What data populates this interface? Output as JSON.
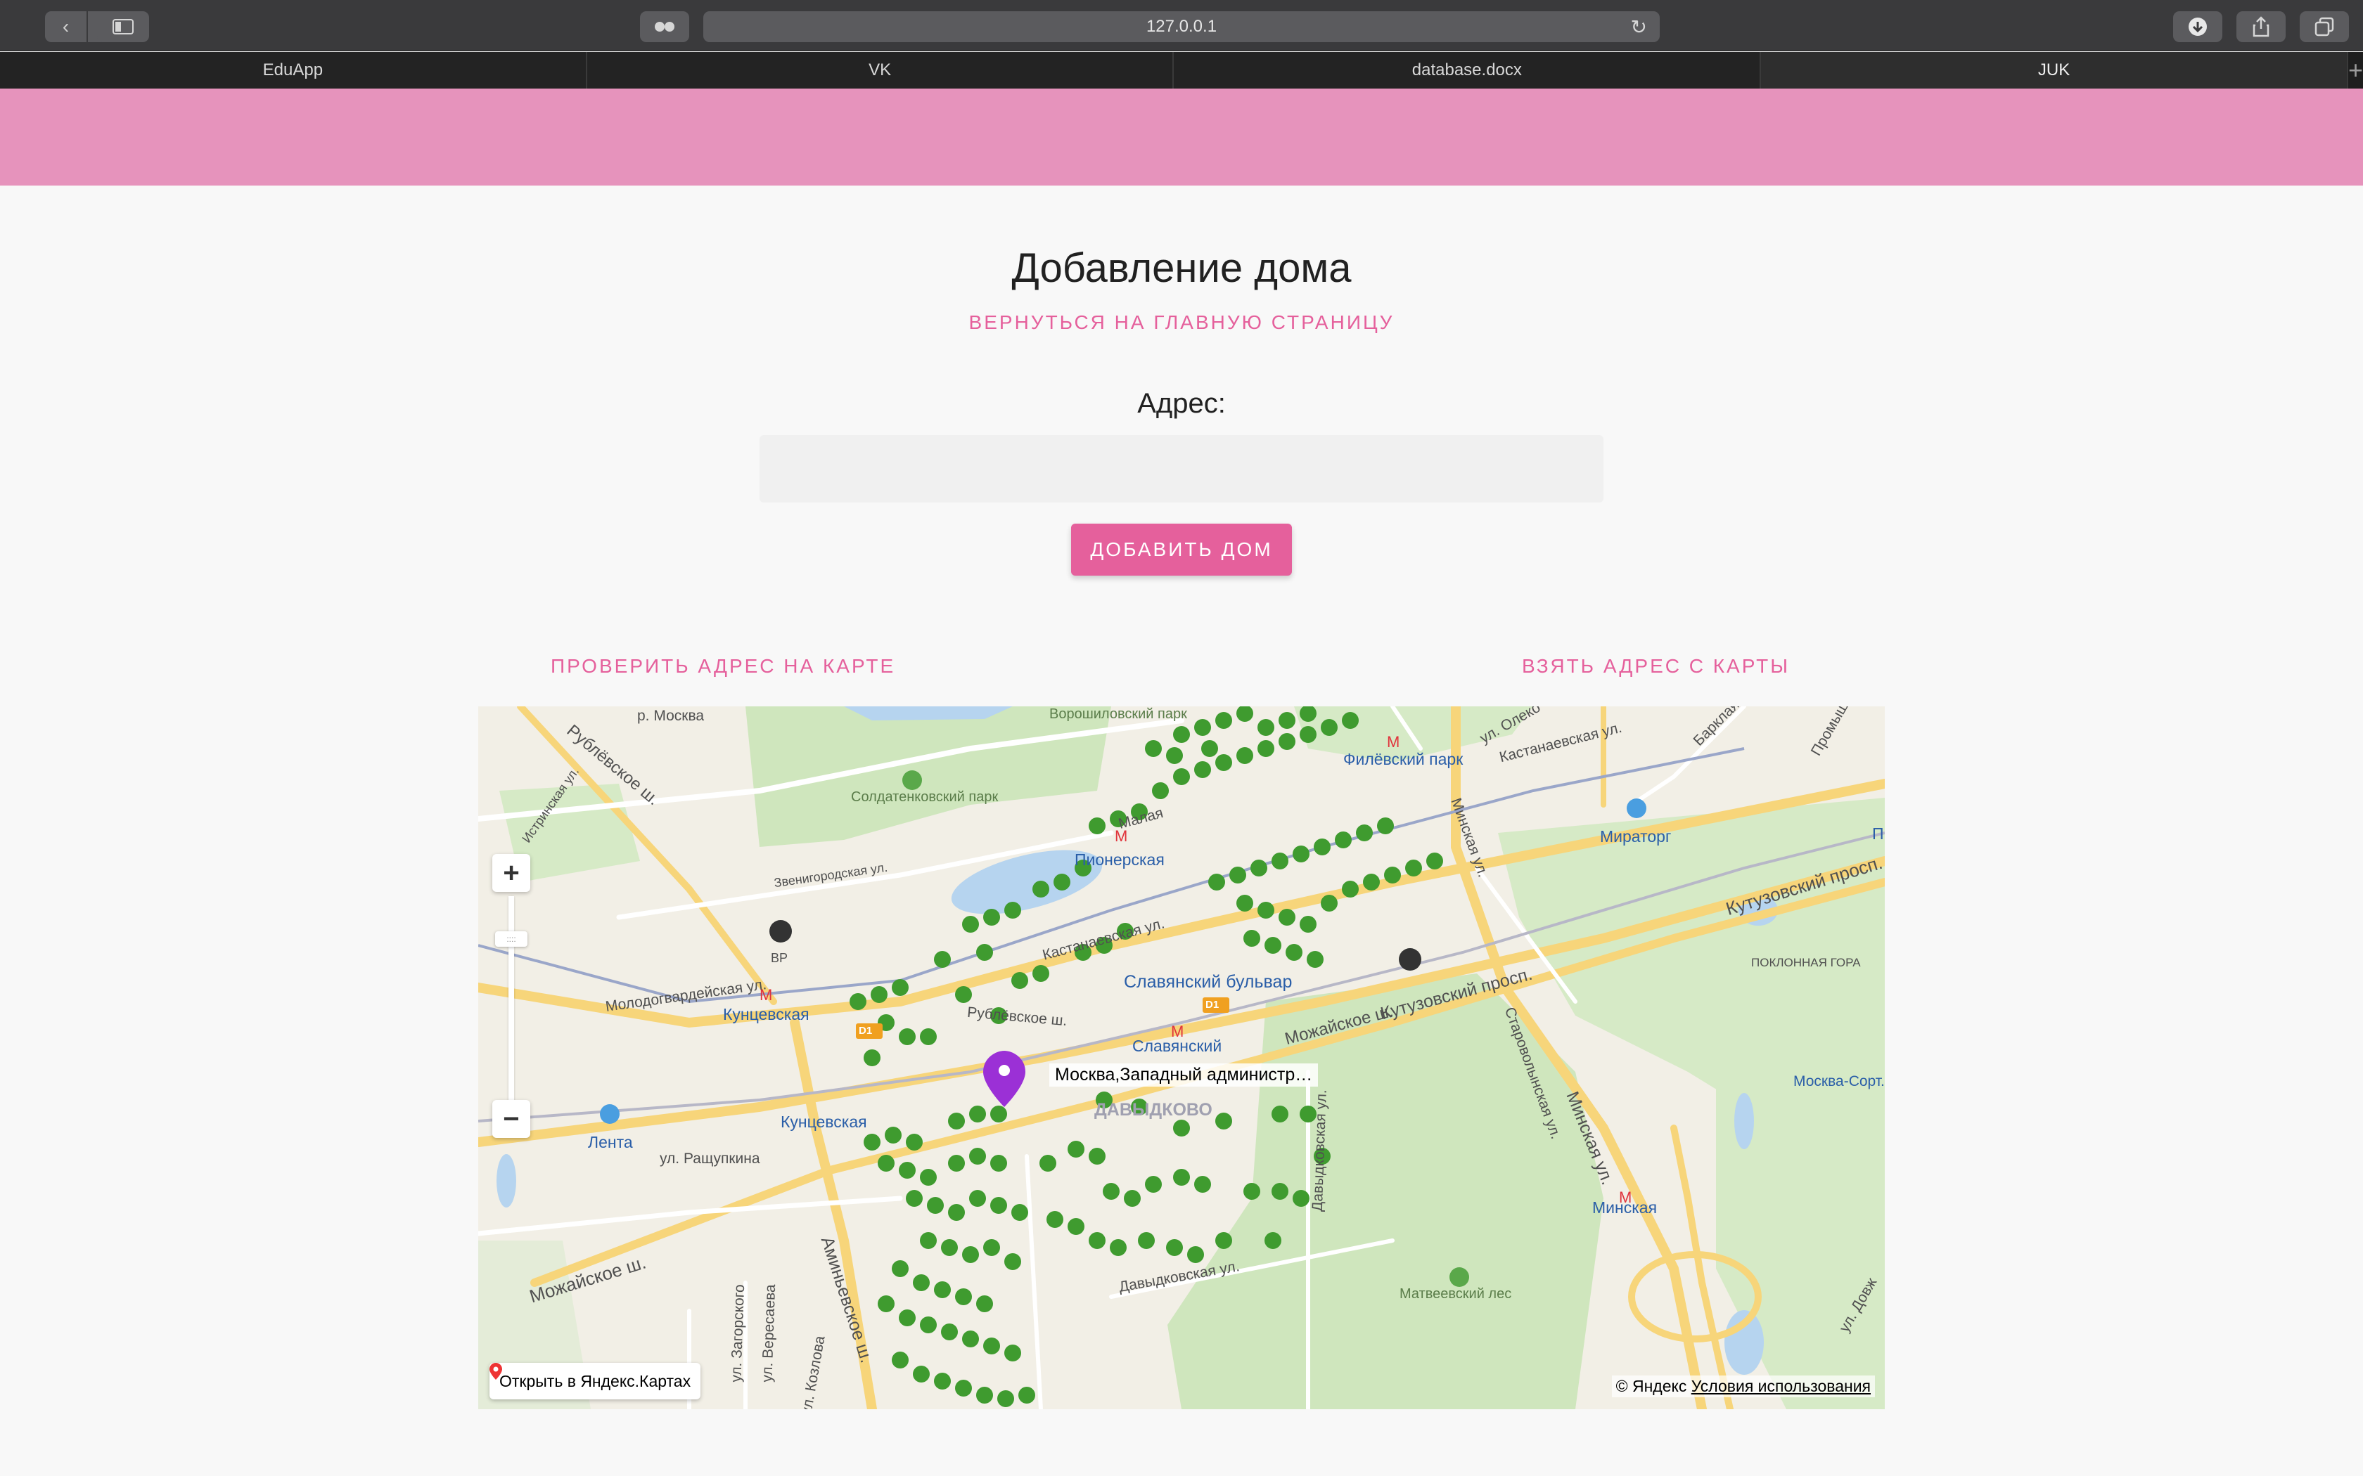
{
  "browser": {
    "url": "127.0.0.1",
    "tabs": [
      {
        "label": "EduApp"
      },
      {
        "label": "VK"
      },
      {
        "label": "database.docx"
      },
      {
        "label": "JUK"
      }
    ]
  },
  "page": {
    "title": "Добавление дома",
    "back_link": "Вернуться на главную страницу",
    "address_label": "Адрес:",
    "address_value": "",
    "address_placeholder": "",
    "add_button": "Добавить дом",
    "check_link": "Проверить адрес на карте",
    "take_link": "Взять адрес с карты",
    "accent_color": "#e5609c",
    "header_color": "#e693bc"
  },
  "map": {
    "marker_label": "Москва,Западный администр…",
    "open_link": "Открыть в Яндекс.Картах",
    "copyright": "© Яндекс",
    "terms": "Условия использования",
    "zoom_in": "+",
    "zoom_out": "−",
    "zoom_thumb": "::::",
    "labels": {
      "moskva_river": "р. Москва",
      "voroshilovsky": "Ворошиловский парк",
      "soldatenkovsky": "Солдатенковский парк",
      "filevsky": "Филёвский парк",
      "kastanaevskaya1": "Кастанаевская ул.",
      "miratorg": "Мираторг",
      "olenya": "ул. Олеко",
      "barklaya": "Барклая",
      "promyshlennaya": "Промыш",
      "rublevskoe1": "Рублёвское ш.",
      "istrinskaya": "Истринская ул.",
      "zvenigorodskaya": "Звенигородская ул.",
      "malaya": "Малая",
      "pionerskaya": "Пионерская",
      "minskaya1": "Минская ул.",
      "kutuzovsky1": "Кутузовский просп.",
      "poklonnaya": "ПОКЛОННАЯ ГОРА",
      "bp": "ВР",
      "kastanaevskaya2": "Кастанаевская ул.",
      "slavyansky_bulvar": "Славянский бульвар",
      "slavyansky": "Славянский",
      "molodogvardeyskaya": "Молодогвардейская ул.",
      "kuntsevskaya1": "Кунцевская",
      "rublevskoe2": "Рублёвское ш.",
      "kutuzovsky2": "Кутузовский просп.",
      "starovolynskaya": "Староволынская ул.",
      "mozhayskoe1": "Можайское ш.",
      "davydkovo": "ДАВЫДКОВО",
      "davydkovskaya": "Давыдковская ул.",
      "kuntsevskaya2": "Кунцевская",
      "lenta": "Лента",
      "rashchupkina": "ул. Ращупкина",
      "minskaya2": "Минская ул.",
      "minskaya_metro": "Минская",
      "kievskaya": "Москва-Сорт. Киевская",
      "aminevskoe": "Аминьевское ш.",
      "mozhayskoe2": "Можайское ш.",
      "matveevsky": "Матвеевский лес",
      "zagorskogo": "ул. Загорского",
      "veresaeva": "ул. Вересаева",
      "kozlova": "ул. Козлова",
      "davydkovskaya2": "Давыдковская ул.",
      "dovzhenko": "ул. Довж",
      "p": "П",
      "d1a": "D1",
      "d1b": "D1"
    }
  }
}
